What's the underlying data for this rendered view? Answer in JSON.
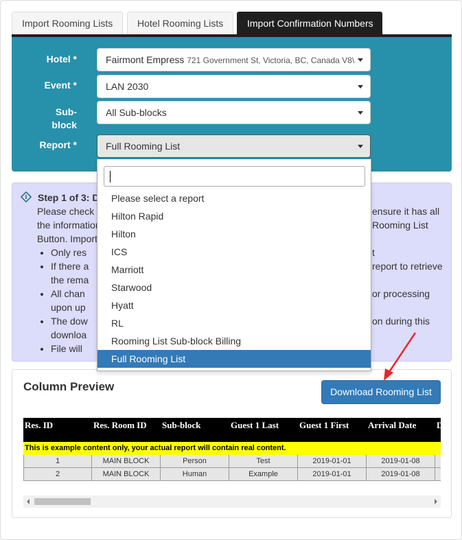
{
  "tabs": [
    {
      "label": "Import Rooming Lists"
    },
    {
      "label": "Hotel Rooming Lists"
    },
    {
      "label": "Import Confirmation Numbers"
    }
  ],
  "form": {
    "hotel_label": "Hotel *",
    "hotel_value": "Fairmont Empress",
    "hotel_address": "721 Government St, Victoria, BC, Canada V8\\",
    "event_label": "Event *",
    "event_value": "LAN 2030",
    "subblock_label_1": "Sub-",
    "subblock_label_2": "block",
    "subblock_value": "All Sub-blocks",
    "report_label": "Report *",
    "report_value": "Full Rooming List"
  },
  "dropdown": {
    "search_value": "",
    "options": [
      "Please select a report",
      "Hilton Rapid",
      "Hilton",
      "ICS",
      "Marriott",
      "Starwood",
      "Hyatt",
      "RL",
      "Rooming List Sub-block Billing",
      "Full Rooming List"
    ],
    "selected": "Full Rooming List"
  },
  "info": {
    "step": "Step 1 of 3: D",
    "line1_left": "Please check t",
    "line1_right": "ensure it has all",
    "line2_left": "the information",
    "line2_right": "Rooming List",
    "line3_left": "Button. Import",
    "bullets_left": [
      "Only res",
      "If there a",
      "the rema",
      "All chan",
      "upon up",
      "The dow",
      "downloa",
      "File will"
    ],
    "bullets_right": {
      "b1": "t",
      "b2": "report to retrieve",
      "b3": "or processing",
      "b4": "on during this"
    }
  },
  "preview": {
    "title": "Column Preview",
    "download_label": "Download Rooming List",
    "columns": [
      "Res. ID",
      "Res. Room ID",
      "Sub-block",
      "Guest 1 Last",
      "Guest 1 First",
      "Arrival Date",
      "D"
    ],
    "note": "This is example content only, your actual report will contain real content.",
    "rows": [
      [
        "1",
        "MAIN BLOCK",
        "Person",
        "Test",
        "2019-01-01",
        "2019-01-08",
        ""
      ],
      [
        "2",
        "MAIN BLOCK",
        "Human",
        "Example",
        "2019-01-01",
        "2019-01-08",
        ""
      ]
    ]
  },
  "colors": {
    "panel": "#2790ab",
    "tab_active": "#1f1f1f",
    "info_bg": "#dcdcfb",
    "primary": "#337ab7",
    "note_bg": "#ffff00",
    "arrow": "#e8262b"
  }
}
